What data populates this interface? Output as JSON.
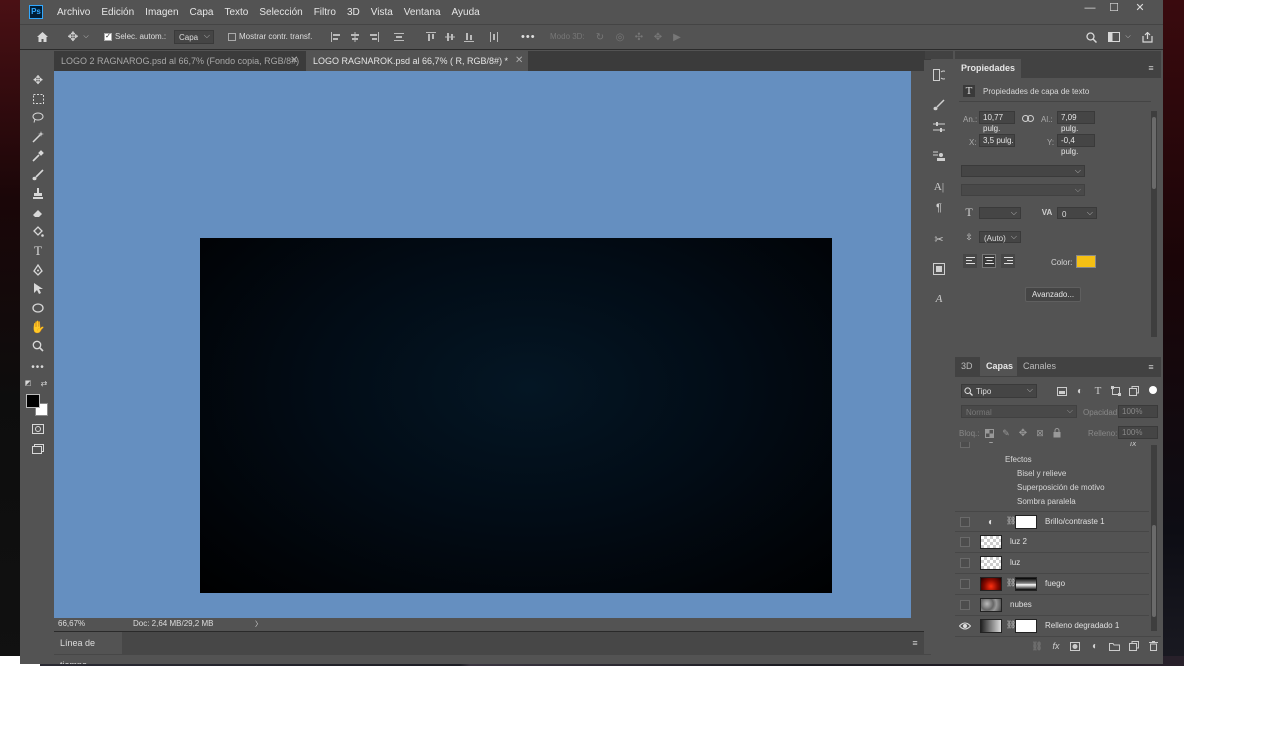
{
  "app": {
    "logo": "Ps"
  },
  "menu": [
    "Archivo",
    "Edición",
    "Imagen",
    "Capa",
    "Texto",
    "Selección",
    "Filtro",
    "3D",
    "Vista",
    "Ventana",
    "Ayuda"
  ],
  "window_buttons": {
    "minimize": "—",
    "maximize": "☐",
    "close": "✕"
  },
  "options_bar": {
    "auto_select_label": "Selec. autom.:",
    "auto_select_value": "Capa",
    "show_transform_label": "Mostrar contr. transf.",
    "mode3d_label": "Modo 3D:",
    "more": "•••"
  },
  "tabs": [
    {
      "label": "LOGO 2 RAGNAROG.psd al 66,7% (Fondo copia, RGB/8#) *",
      "close": "✕"
    },
    {
      "label": "LOGO RAGNAROK.psd al 66,7% ( R, RGB/8#) *",
      "close": "✕"
    }
  ],
  "status": {
    "zoom": "66,67%",
    "doc": "Doc: 2,64 MB/29,2 MB",
    "arrow": "〉"
  },
  "timeline": {
    "label": "Línea de tiempo"
  },
  "properties": {
    "tab": "Propiedades",
    "section": "Propiedades de capa de texto",
    "width_label": "An.:",
    "width_value": "10,77 pulg.",
    "height_label": "Al.:",
    "height_value": "7,09 pulg.",
    "x_label": "X:",
    "x_value": "3,5 pulg.",
    "y_label": "Y:",
    "y_value": "-0,4 pulg.",
    "tracking_value": "0",
    "leading_value": "(Auto)",
    "color_label": "Color:",
    "color_swatch": "#f5c014",
    "advanced_button": "Avanzado..."
  },
  "layers_panel": {
    "tabs": [
      "3D",
      "Capas",
      "Canales"
    ],
    "filter_label": "Tipo",
    "blend_mode": "Normal",
    "opacity_label": "Opacidad:",
    "opacity_value": "100%",
    "lock_label": "Bloq.:",
    "fill_label": "Relleno:",
    "fill_value": "100%",
    "effects_header": "Efectos",
    "effects": [
      "Bisel y relieve",
      "Superposición de motivo",
      "Sombra paralela"
    ],
    "layers": [
      {
        "name": "Brillo/contraste 1"
      },
      {
        "name": "luz 2"
      },
      {
        "name": "luz"
      },
      {
        "name": "fuego"
      },
      {
        "name": "nubes"
      },
      {
        "name": "Relleno degradado 1"
      }
    ]
  }
}
